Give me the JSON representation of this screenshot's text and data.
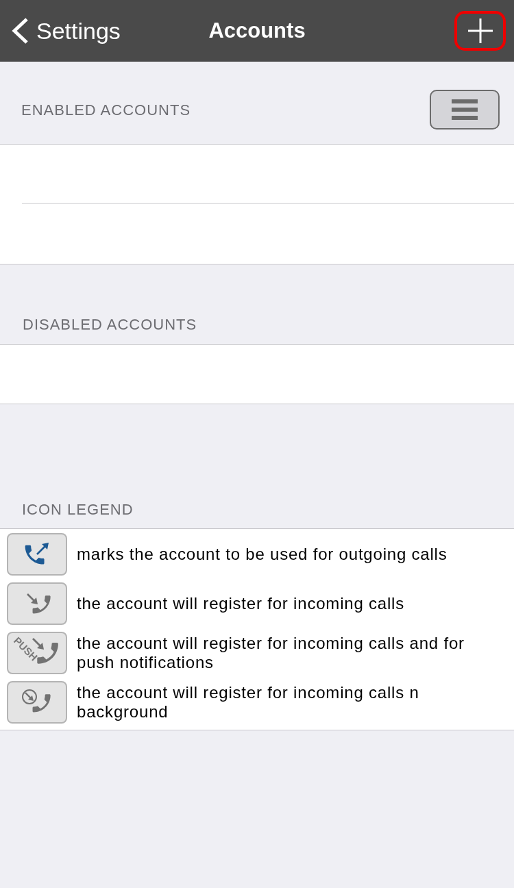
{
  "nav_bar": {
    "back_label": "Settings",
    "title": "Accounts",
    "add_button": {
      "highlighted": true
    }
  },
  "enabled_accounts": {
    "header": "ENABLED ACCOUNTS"
  },
  "disabled_accounts": {
    "header": "DISABLED ACCOUNTS"
  },
  "icon_legend": {
    "header": "ICON LEGEND",
    "items": [
      {
        "kind": "outgoing",
        "text": "marks the account to be used for outgoing calls"
      },
      {
        "kind": "incoming",
        "text": "the account will register for incoming calls"
      },
      {
        "kind": "push",
        "icon_label": "PUSH",
        "text": "the account will register for incoming calls and for push notifications"
      },
      {
        "kind": "background",
        "text": "the account will register for incoming calls n background"
      }
    ]
  }
}
